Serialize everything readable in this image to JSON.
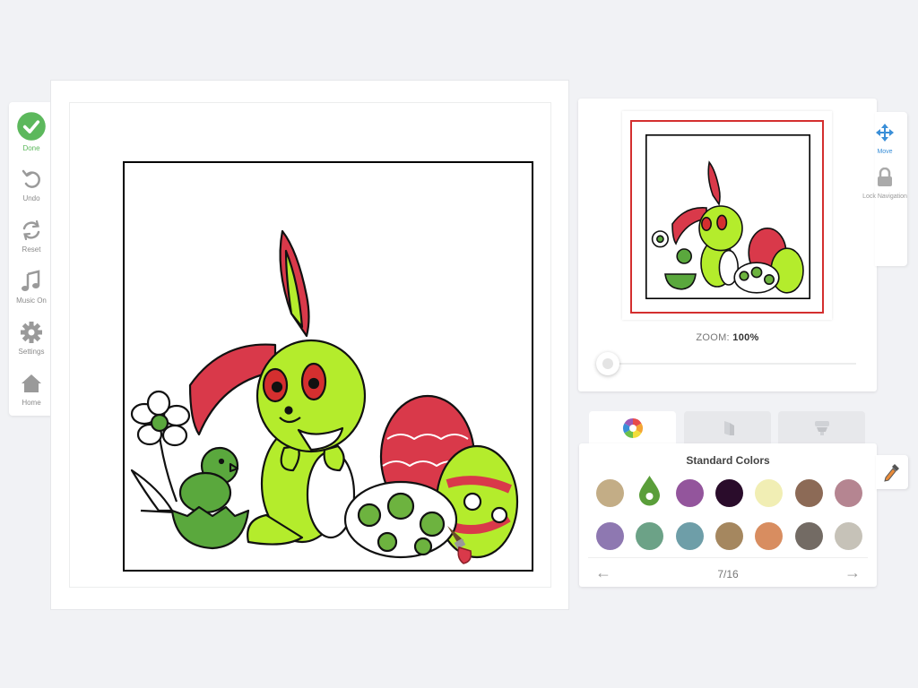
{
  "toolbar": {
    "done": "Done",
    "undo": "Undo",
    "reset": "Reset",
    "music": "Music On",
    "settings": "Settings",
    "home": "Home"
  },
  "navigator": {
    "zoom_label": "ZOOM:",
    "zoom_value": "100%",
    "zoom_level_pct": 0
  },
  "nav_tools": {
    "move": "Move",
    "lock": "Lock Navigation"
  },
  "palette": {
    "title": "Standard Colors",
    "page": "7/16",
    "selected_index": 1,
    "swatches": [
      "#c3ad86",
      "#5a9e3a",
      "#93559c",
      "#2a0c2b",
      "#f1eeb4",
      "#8c6a56",
      "#b58591",
      "#8e78b1",
      "#6ca287",
      "#6e9ea8",
      "#a5875f",
      "#d88d60",
      "#736b64",
      "#c6c2b8"
    ]
  },
  "colors": {
    "accent_green": "#5cb85c",
    "view_frame": "#d42f2f",
    "bunny_green": "#b4ec2c",
    "ear_red": "#d9394a",
    "chick_green": "#5aa83d",
    "egg_green": "#6db33f"
  },
  "icons": {
    "done": "check-circle-icon",
    "undo": "undo-icon",
    "reset": "reset-icon",
    "music": "music-note-icon",
    "settings": "gear-icon",
    "home": "home-icon",
    "move": "move-arrows-icon",
    "lock": "lock-icon",
    "tab1": "color-wheel-icon",
    "tab2": "gradient-icon",
    "tab3": "paint-bucket-icon",
    "eyedropper": "eyedropper-icon",
    "brush": "paintbrush-cursor-icon"
  }
}
